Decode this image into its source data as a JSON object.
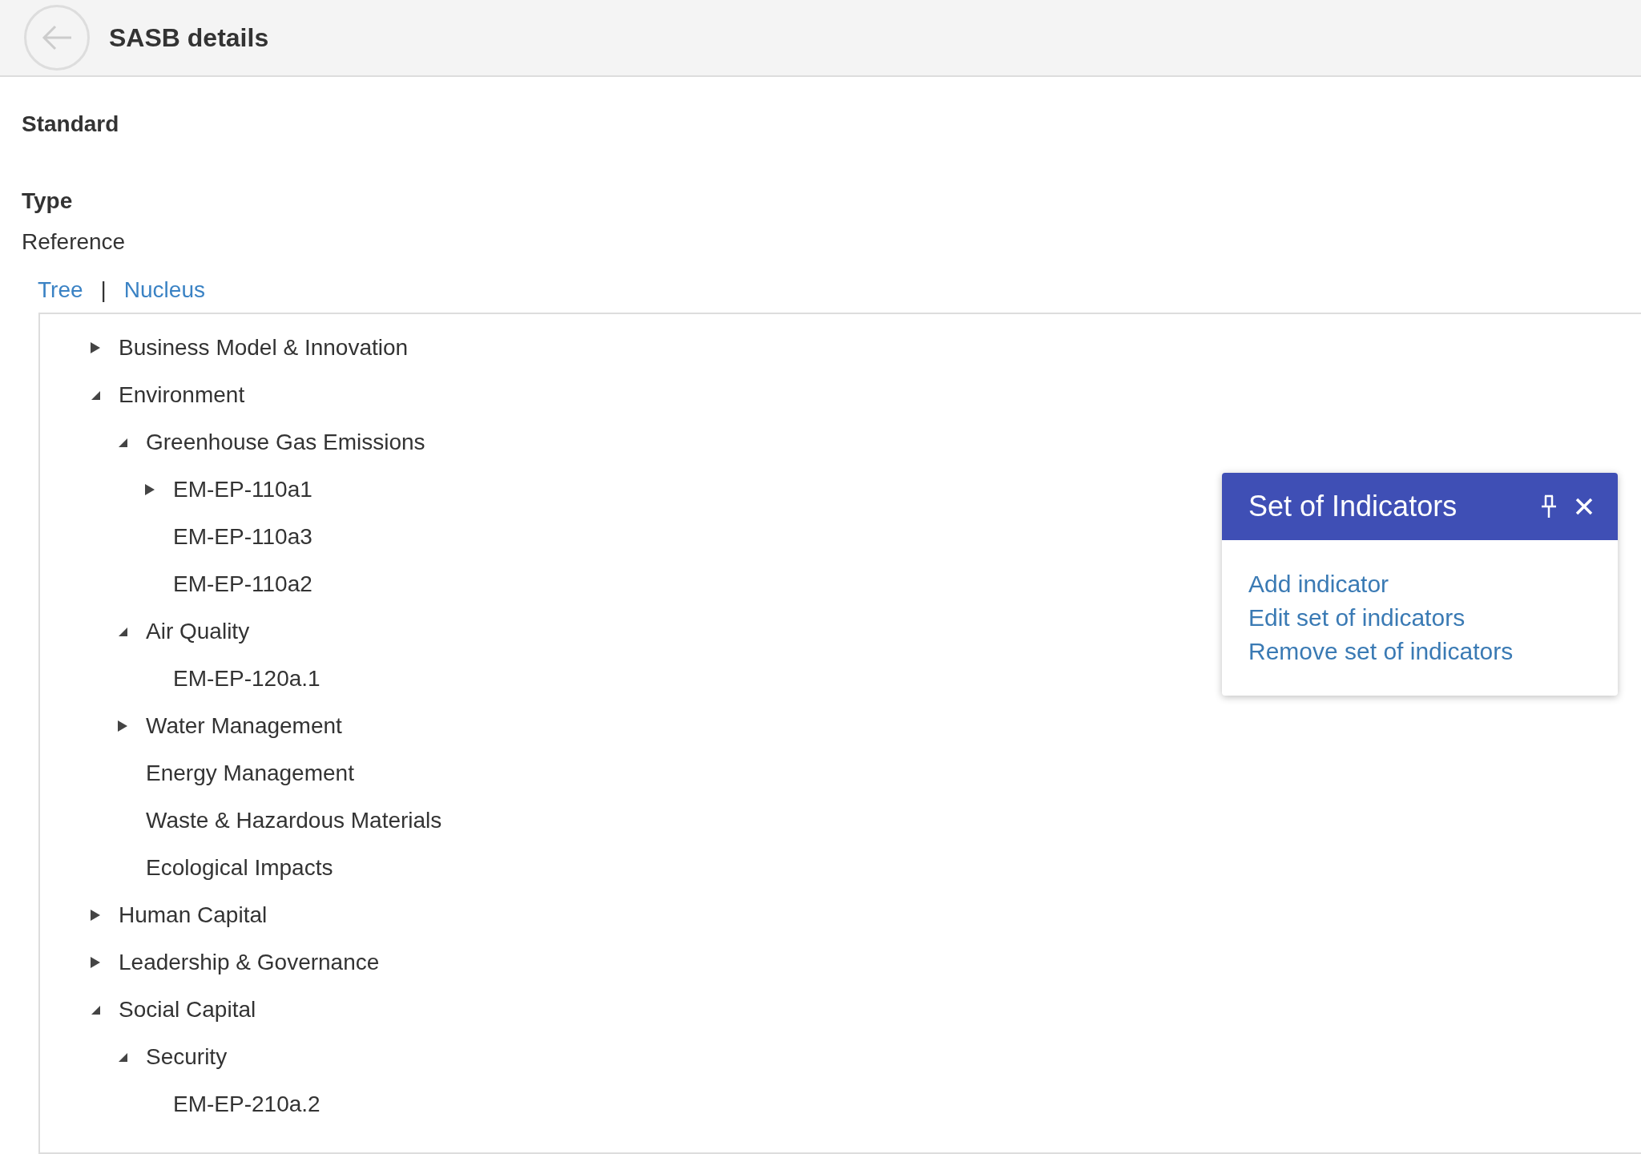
{
  "header": {
    "title": "SASB details"
  },
  "fields": [
    {
      "label": "Standard"
    },
    {
      "label": "Type",
      "value": "Reference"
    }
  ],
  "view_tabs": [
    "Tree",
    "Nucleus"
  ],
  "view_tab_separator": "|",
  "tree": [
    {
      "label": "Business Model & Innovation",
      "kind": "branch",
      "expanded": false
    },
    {
      "label": "Environment",
      "kind": "branch",
      "expanded": true,
      "children": [
        {
          "label": "Greenhouse Gas Emissions",
          "kind": "branch",
          "expanded": true,
          "children": [
            {
              "label": "EM-EP-110a1",
              "kind": "branch",
              "expanded": false
            },
            {
              "label": "EM-EP-110a3",
              "kind": "leaf"
            },
            {
              "label": "EM-EP-110a2",
              "kind": "leaf"
            }
          ]
        },
        {
          "label": "Air Quality",
          "kind": "branch",
          "expanded": true,
          "children": [
            {
              "label": "EM-EP-120a.1",
              "kind": "leaf"
            }
          ]
        },
        {
          "label": "Water Management",
          "kind": "branch",
          "expanded": false
        },
        {
          "label": "Energy Management",
          "kind": "leaf"
        },
        {
          "label": "Waste & Hazardous Materials",
          "kind": "leaf"
        },
        {
          "label": "Ecological Impacts",
          "kind": "leaf"
        }
      ]
    },
    {
      "label": "Human Capital",
      "kind": "branch",
      "expanded": false
    },
    {
      "label": "Leadership & Governance",
      "kind": "branch",
      "expanded": false
    },
    {
      "label": "Social Capital",
      "kind": "branch",
      "expanded": true,
      "children": [
        {
          "label": "Security",
          "kind": "branch",
          "expanded": true,
          "children": [
            {
              "label": "EM-EP-210a.2",
              "kind": "leaf"
            }
          ]
        }
      ]
    }
  ],
  "popup": {
    "title": "Set of Indicators",
    "actions": [
      "Add indicator",
      "Edit set of indicators",
      "Remove set of indicators"
    ]
  }
}
